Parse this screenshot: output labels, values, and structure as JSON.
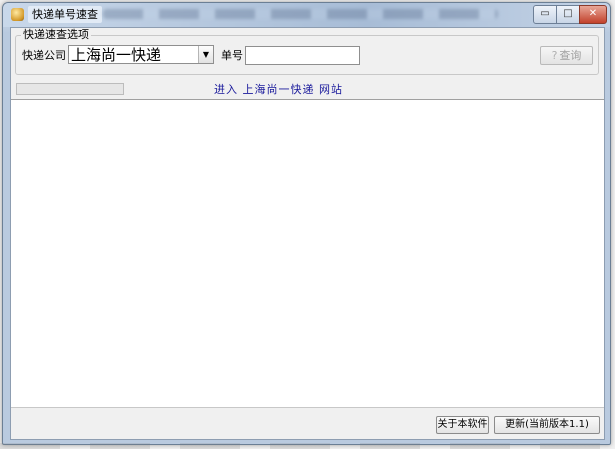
{
  "window": {
    "title": "快递单号速查",
    "controls": {
      "minimize": "▭",
      "maximize": "□",
      "close": "✕"
    }
  },
  "search_group": {
    "legend": "快递速查选项",
    "company_label": "快递公司",
    "company_value": "上海尚一快递",
    "order_label": "单号",
    "order_value": "",
    "query_button": "查询",
    "query_icon": "?"
  },
  "site_link": "进入 上海尚一快递 网站",
  "footer": {
    "about_button": "关于本软件",
    "update_button": "更新(当前版本1.1)"
  },
  "colors": {
    "link": "#1a1a9c",
    "disabled_text": "#a0a0a0"
  }
}
